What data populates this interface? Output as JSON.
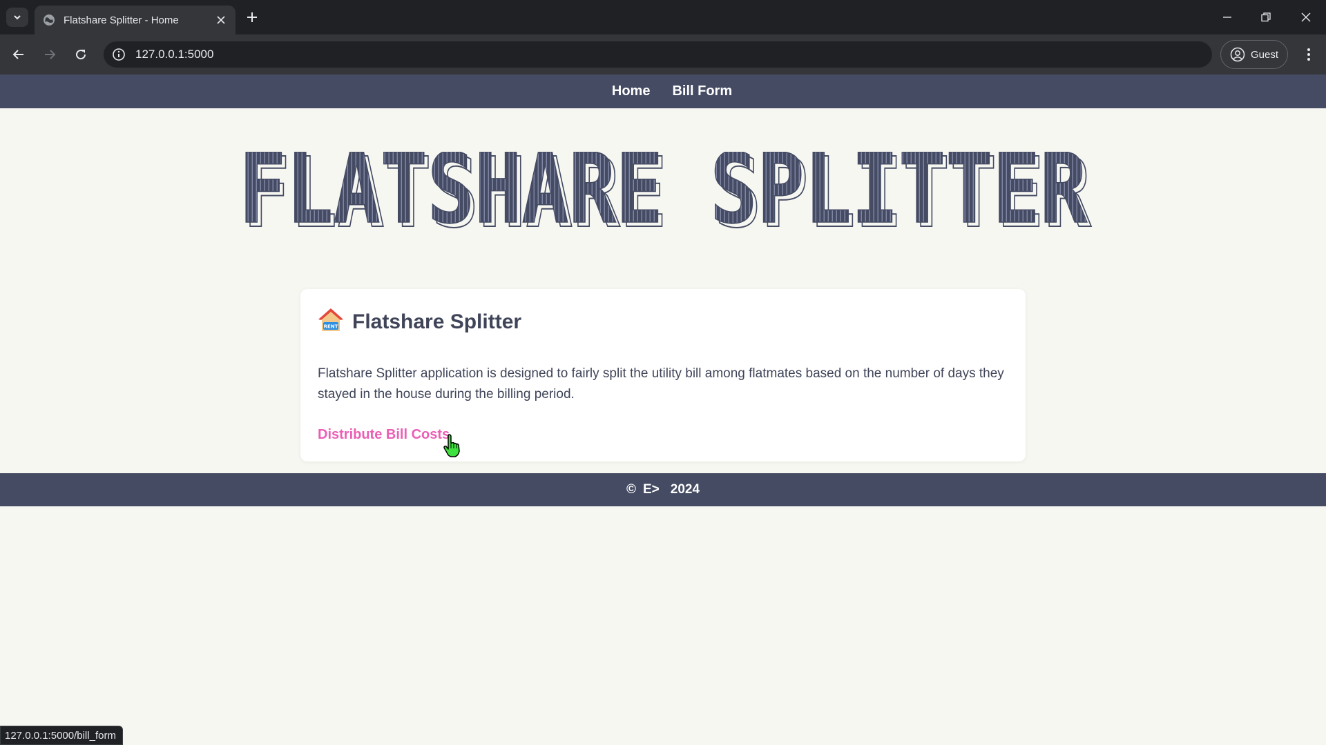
{
  "browser": {
    "tab_title": "Flatshare Splitter - Home",
    "url": "127.0.0.1:5000",
    "profile_label": "Guest",
    "status_url": "127.0.0.1:5000/bill_form"
  },
  "site_nav": {
    "items": [
      {
        "label": "Home"
      },
      {
        "label": "Bill Form"
      }
    ]
  },
  "banner": {
    "text": "FLATSHARE SPLITTER"
  },
  "card": {
    "emoji": "🏠",
    "title": "Flatshare Splitter",
    "description": "Flatshare Splitter application is designed to fairly split the utility bill among flatmates based on the number of days they stayed in the house during the billing period.",
    "link_label": "Distribute Bill Costs"
  },
  "footer": {
    "copyright_symbol": "©",
    "author": "E>",
    "year": "2024"
  },
  "colors": {
    "nav_bg": "#444b63",
    "page_bg": "#f7f7f2",
    "link_pink": "#ec5eb5",
    "heading_text": "#3f4458"
  },
  "icons": {
    "tab_search": "chevron-down-icon",
    "favicon": "globe-icon",
    "tab_close": "close-icon",
    "new_tab": "plus-icon",
    "back": "arrow-left-icon",
    "forward": "arrow-right-icon",
    "reload": "reload-icon",
    "site_info": "info-icon",
    "profile": "person-icon",
    "menu": "kebab-menu-icon",
    "cursor": "hand-pointer-icon"
  }
}
